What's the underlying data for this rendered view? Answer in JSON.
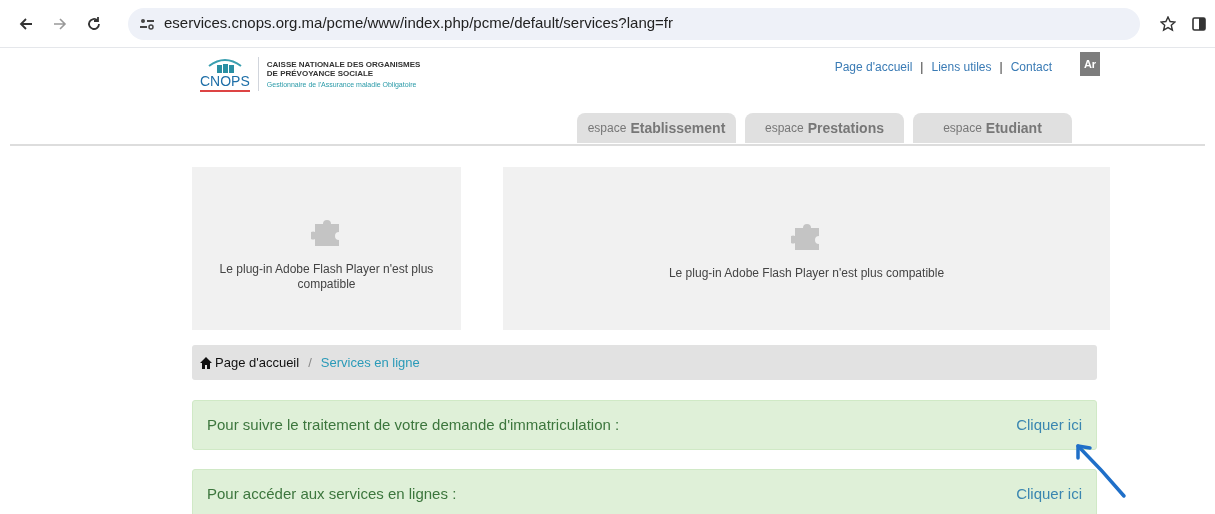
{
  "browser": {
    "url": "eservices.cnops.org.ma/pcme/www/index.php/pcme/default/services?lang=fr"
  },
  "header": {
    "logo": {
      "brand": "CNOPS",
      "line_1": "CAISSE NATIONALE DES ORGANISMES",
      "line_2": "DE PRÉVOYANCE SOCIALE",
      "tagline": "Gestionnaire de l'Assurance maladie Obligatoire"
    },
    "top_links": [
      "Page d'accueil",
      "Liens utiles",
      "Contact"
    ],
    "link_separator": "|",
    "language_button": "Ar",
    "tabs": [
      {
        "prefix": "espace",
        "label": "Etablissement"
      },
      {
        "prefix": "espace",
        "label": "Prestations"
      },
      {
        "prefix": "espace",
        "label": "Etudiant"
      }
    ]
  },
  "plugins": [
    {
      "message": "Le plug-in Adobe Flash Player n'est plus compatible"
    },
    {
      "message": "Le plug-in Adobe Flash Player n'est plus compatible"
    }
  ],
  "breadcrumb": [
    "Page d'accueil",
    "Services en ligne"
  ],
  "breadcrumb_separator": "/",
  "services": [
    {
      "text": "Pour suivre le traitement de votre demande d'immatriculation :",
      "link": "Cliquer ici"
    },
    {
      "text": "Pour accéder aux services en lignes :",
      "link": "Cliquer ici"
    }
  ]
}
